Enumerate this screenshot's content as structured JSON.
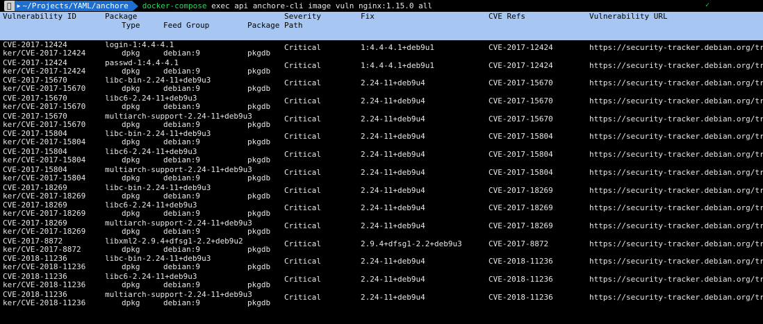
{
  "prompt": {
    "apple_icon": "apple-icon",
    "path": "~/Projects/YAML/anchore",
    "command_name": "docker-compose",
    "command_args": " exec api anchore-cli image vuln nginx:1.15.0 all",
    "status_mark": "✓"
  },
  "header": {
    "vuln_id": "Vulnerability ID",
    "package": "Package",
    "type": "Type",
    "feed_group": "Feed Group",
    "package_path": "Package Path",
    "severity": "Severity",
    "fix": "Fix",
    "cve_refs": "CVE Refs",
    "vuln_url": "Vulnerability URL"
  },
  "rows": [
    {
      "id": "CVE-2017-12424",
      "wrap": "ker/CVE-2017-12424",
      "package": "login-1:4.4-4.1",
      "type": "dpkg",
      "feed": "debian:9",
      "path": "pkgdb",
      "severity": "Critical",
      "fix": "1:4.4-4.1+deb9u1",
      "cve": "CVE-2017-12424",
      "url": "https://security-tracker.debian.org/trac"
    },
    {
      "id": "CVE-2017-12424",
      "wrap": "ker/CVE-2017-12424",
      "package": "passwd-1:4.4-4.1",
      "type": "dpkg",
      "feed": "debian:9",
      "path": "pkgdb",
      "severity": "Critical",
      "fix": "1:4.4-4.1+deb9u1",
      "cve": "CVE-2017-12424",
      "url": "https://security-tracker.debian.org/trac"
    },
    {
      "id": "CVE-2017-15670",
      "wrap": "ker/CVE-2017-15670",
      "package": "libc-bin-2.24-11+deb9u3",
      "type": "dpkg",
      "feed": "debian:9",
      "path": "pkgdb",
      "severity": "Critical",
      "fix": "2.24-11+deb9u4",
      "cve": "CVE-2017-15670",
      "url": "https://security-tracker.debian.org/trac"
    },
    {
      "id": "CVE-2017-15670",
      "wrap": "ker/CVE-2017-15670",
      "package": "libc6-2.24-11+deb9u3",
      "type": "dpkg",
      "feed": "debian:9",
      "path": "pkgdb",
      "severity": "Critical",
      "fix": "2.24-11+deb9u4",
      "cve": "CVE-2017-15670",
      "url": "https://security-tracker.debian.org/trac"
    },
    {
      "id": "CVE-2017-15670",
      "wrap": "ker/CVE-2017-15670",
      "package": "multiarch-support-2.24-11+deb9u3",
      "type": "dpkg",
      "feed": "debian:9",
      "path": "pkgdb",
      "severity": "Critical",
      "fix": "2.24-11+deb9u4",
      "cve": "CVE-2017-15670",
      "url": "https://security-tracker.debian.org/trac"
    },
    {
      "id": "CVE-2017-15804",
      "wrap": "ker/CVE-2017-15804",
      "package": "libc-bin-2.24-11+deb9u3",
      "type": "dpkg",
      "feed": "debian:9",
      "path": "pkgdb",
      "severity": "Critical",
      "fix": "2.24-11+deb9u4",
      "cve": "CVE-2017-15804",
      "url": "https://security-tracker.debian.org/trac"
    },
    {
      "id": "CVE-2017-15804",
      "wrap": "ker/CVE-2017-15804",
      "package": "libc6-2.24-11+deb9u3",
      "type": "dpkg",
      "feed": "debian:9",
      "path": "pkgdb",
      "severity": "Critical",
      "fix": "2.24-11+deb9u4",
      "cve": "CVE-2017-15804",
      "url": "https://security-tracker.debian.org/trac"
    },
    {
      "id": "CVE-2017-15804",
      "wrap": "ker/CVE-2017-15804",
      "package": "multiarch-support-2.24-11+deb9u3",
      "type": "dpkg",
      "feed": "debian:9",
      "path": "pkgdb",
      "severity": "Critical",
      "fix": "2.24-11+deb9u4",
      "cve": "CVE-2017-15804",
      "url": "https://security-tracker.debian.org/trac"
    },
    {
      "id": "CVE-2017-18269",
      "wrap": "ker/CVE-2017-18269",
      "package": "libc-bin-2.24-11+deb9u3",
      "type": "dpkg",
      "feed": "debian:9",
      "path": "pkgdb",
      "severity": "Critical",
      "fix": "2.24-11+deb9u4",
      "cve": "CVE-2017-18269",
      "url": "https://security-tracker.debian.org/trac"
    },
    {
      "id": "CVE-2017-18269",
      "wrap": "ker/CVE-2017-18269",
      "package": "libc6-2.24-11+deb9u3",
      "type": "dpkg",
      "feed": "debian:9",
      "path": "pkgdb",
      "severity": "Critical",
      "fix": "2.24-11+deb9u4",
      "cve": "CVE-2017-18269",
      "url": "https://security-tracker.debian.org/trac"
    },
    {
      "id": "CVE-2017-18269",
      "wrap": "ker/CVE-2017-18269",
      "package": "multiarch-support-2.24-11+deb9u3",
      "type": "dpkg",
      "feed": "debian:9",
      "path": "pkgdb",
      "severity": "Critical",
      "fix": "2.24-11+deb9u4",
      "cve": "CVE-2017-18269",
      "url": "https://security-tracker.debian.org/trac"
    },
    {
      "id": "CVE-2017-8872",
      "wrap": "ker/CVE-2017-8872",
      "package": "libxml2-2.9.4+dfsg1-2.2+deb9u2",
      "type": "dpkg",
      "feed": "debian:9",
      "path": "pkgdb",
      "severity": "Critical",
      "fix": "2.9.4+dfsg1-2.2+deb9u3",
      "cve": "CVE-2017-8872",
      "url": "https://security-tracker.debian.org/trac"
    },
    {
      "id": "CVE-2018-11236",
      "wrap": "ker/CVE-2018-11236",
      "package": "libc-bin-2.24-11+deb9u3",
      "type": "dpkg",
      "feed": "debian:9",
      "path": "pkgdb",
      "severity": "Critical",
      "fix": "2.24-11+deb9u4",
      "cve": "CVE-2018-11236",
      "url": "https://security-tracker.debian.org/trac"
    },
    {
      "id": "CVE-2018-11236",
      "wrap": "ker/CVE-2018-11236",
      "package": "libc6-2.24-11+deb9u3",
      "type": "dpkg",
      "feed": "debian:9",
      "path": "pkgdb",
      "severity": "Critical",
      "fix": "2.24-11+deb9u4",
      "cve": "CVE-2018-11236",
      "url": "https://security-tracker.debian.org/trac"
    },
    {
      "id": "CVE-2018-11236",
      "wrap": "ker/CVE-2018-11236",
      "package": "multiarch-support-2.24-11+deb9u3",
      "type": "dpkg",
      "feed": "debian:9",
      "path": "pkgdb",
      "severity": "Critical",
      "fix": "2.24-11+deb9u4",
      "cve": "CVE-2018-11236",
      "url": "https://security-tracker.debian.org/trac"
    }
  ]
}
